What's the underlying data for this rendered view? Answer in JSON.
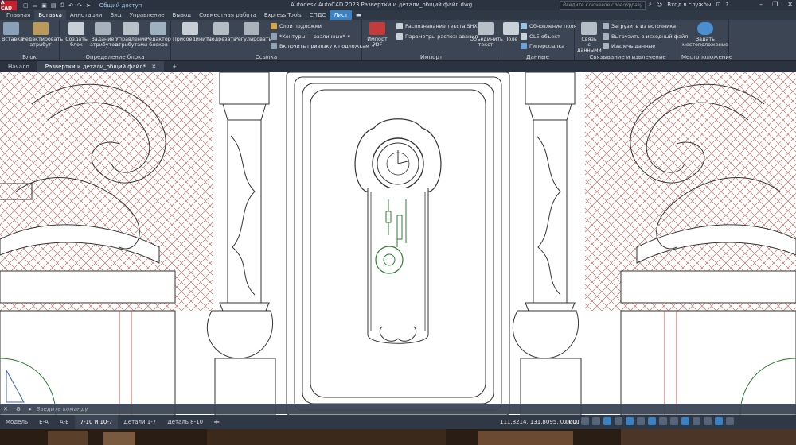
{
  "titlebar": {
    "app_logo": "A CAD",
    "share": "Общий доступ",
    "title": "Autodesk AutoCAD 2023   Развертки и детали_общий файл.dwg",
    "search_placeholder": "Введите ключевое слово/фразу",
    "signin": "Вход в службы"
  },
  "tabs": [
    "Главная",
    "Вставка",
    "Аннотации",
    "Вид",
    "Управление",
    "Вывод",
    "Совместная работа",
    "Express Tools",
    "СПДС",
    "Лист"
  ],
  "ribbon": {
    "block_group": {
      "label": "Блок",
      "insert": "Вставка",
      "edit_attr_1": "Редактировать",
      "edit_attr_2": "атрибут"
    },
    "definition_group": {
      "label": "Определение блока",
      "create_1": "Создать",
      "create_2": "блок",
      "define_1": "Задание",
      "define_2": "атрибутов",
      "manage_1": "Управление",
      "manage_2": "атрибутами",
      "editor_1": "Редактор",
      "editor_2": "блоков"
    },
    "reference_group": {
      "label": "Ссылка",
      "attach": "Присоединить",
      "clip": "Подрезать",
      "adjust": "Регулировать",
      "underlay_layers": "Слои подложки",
      "frames": "*Контуры — различные*",
      "snap": "Включить привязку к подложкам"
    },
    "import_group": {
      "label": "Импорт",
      "pdf_1": "Импорт",
      "pdf_2": "PDF",
      "shx": "Распознавание текста SHX",
      "params": "Параметры распознавания",
      "combine_1": "Объединить",
      "combine_2": "текст"
    },
    "data_group": {
      "label": "Данные",
      "field": "Поле",
      "update": "Обновление  поля",
      "ole": "OLE-объект",
      "hyperlink": "Гиперссылка"
    },
    "link_group": {
      "label": "Связывание и извлечение",
      "link_1": "Связь",
      "link_2": "с данными",
      "load": "Загрузить из источника",
      "upload": "Выгрузить в исходный файл",
      "extract": "Извлечь  данные"
    },
    "location_group": {
      "label": "Местоположение",
      "set_1": "Задать",
      "set_2": "местоположение"
    }
  },
  "doc_tabs": {
    "start": "Начало",
    "file": "Развертки и детали_общий файл*"
  },
  "command_line": {
    "placeholder": "Введите  команду"
  },
  "layout_tabs": [
    "Модель",
    "Е-А",
    "А-Е",
    "7-10 и 10-7",
    "Детали 1-7",
    "Деталь  8-10"
  ],
  "active_layout": "7-10 и 10-7",
  "status": {
    "coords": "111.8214, 131.8095, 0.0000",
    "mode": "ЛИСТ"
  },
  "colors": {
    "titlebar": "#2b3340",
    "ribbon": "#3b4554",
    "accent": "#3b82c4",
    "brick_red": "#b5564e",
    "pendulum_green": "#2f7d32"
  }
}
